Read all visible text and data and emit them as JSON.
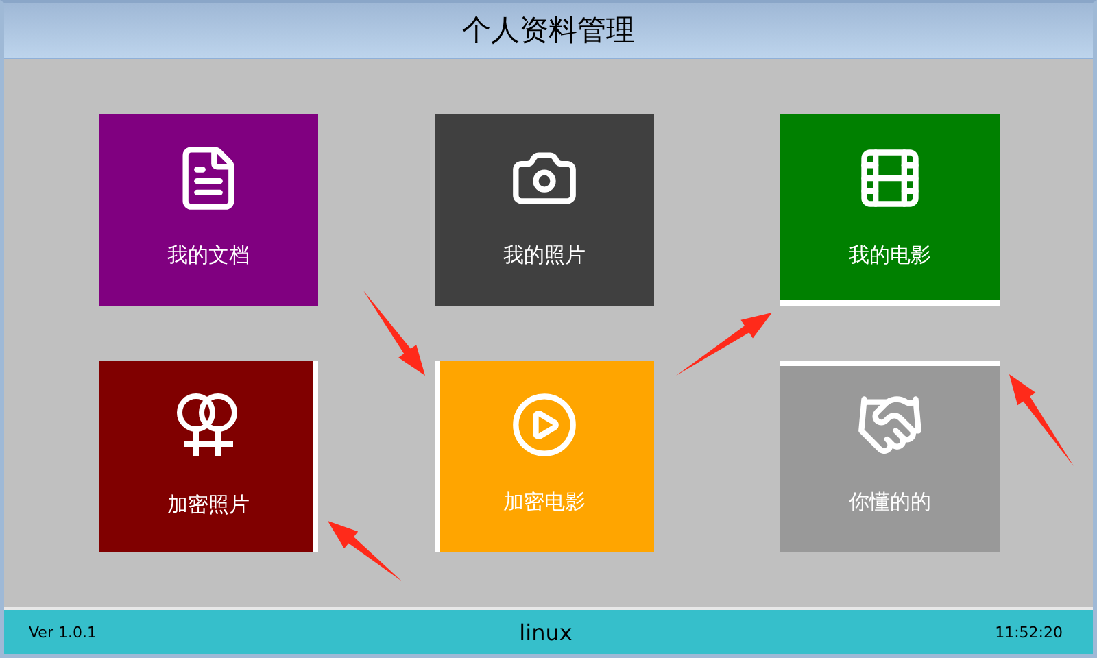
{
  "window": {
    "title": "个人资料管理"
  },
  "tiles": [
    {
      "label": "我的文档",
      "kind": "document",
      "color": "#800080",
      "edge_top": false,
      "edge_bottom": false,
      "edge_left": false,
      "edge_right": false
    },
    {
      "label": "我的照片",
      "kind": "camera",
      "color": "#404040",
      "edge_top": false,
      "edge_bottom": false,
      "edge_left": false,
      "edge_right": false
    },
    {
      "label": "我的电影",
      "kind": "film",
      "color": "#008000",
      "edge_top": false,
      "edge_bottom": true,
      "edge_left": false,
      "edge_right": false
    },
    {
      "label": "加密照片",
      "kind": "venus-pair",
      "color": "#800000",
      "edge_top": false,
      "edge_bottom": false,
      "edge_left": false,
      "edge_right": true
    },
    {
      "label": "加密电影",
      "kind": "play",
      "color": "#ffa500",
      "edge_top": false,
      "edge_bottom": false,
      "edge_left": true,
      "edge_right": false
    },
    {
      "label": "你懂的的",
      "kind": "handshake",
      "color": "#999999",
      "edge_top": true,
      "edge_bottom": false,
      "edge_left": false,
      "edge_right": false
    }
  ],
  "status_bar": {
    "version": "Ver 1.0.1",
    "user": "linux",
    "time": "11:52:20"
  }
}
